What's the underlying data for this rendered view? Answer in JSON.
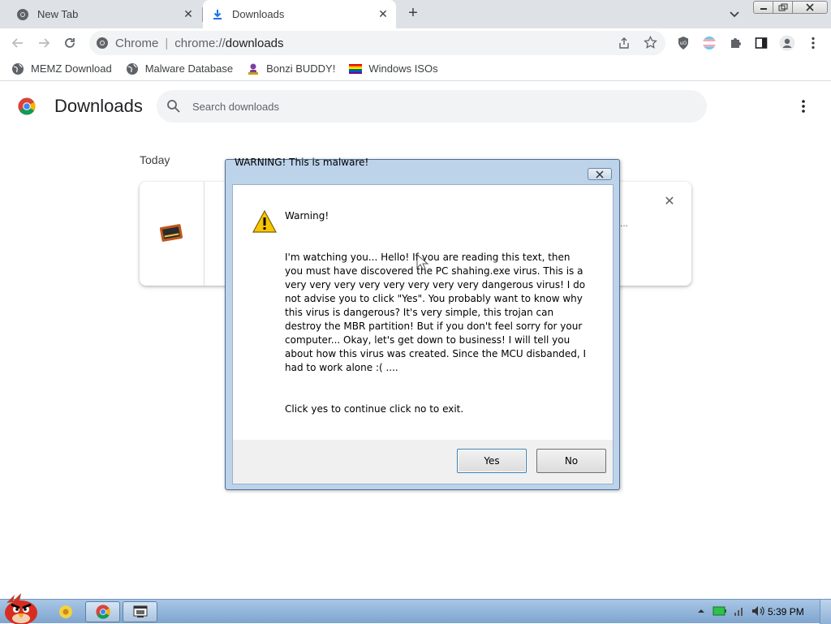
{
  "tabs": [
    {
      "label": "New Tab",
      "icon": "chrome-icon"
    },
    {
      "label": "Downloads",
      "icon": "download-icon",
      "active": true
    }
  ],
  "toolbar": {
    "omnibox_prefix": "Chrome",
    "url_scheme": "chrome://",
    "url_host": "downloads"
  },
  "bookmarks": [
    {
      "label": "MEMZ Download",
      "icon": "globe-icon"
    },
    {
      "label": "Malware Database",
      "icon": "globe-icon"
    },
    {
      "label": "Bonzi BUDDY!",
      "icon": "bonzi-icon"
    },
    {
      "label": "Windows ISOs",
      "icon": "rainbow-flag-icon"
    }
  ],
  "downloads_page": {
    "title": "Downloads",
    "search_placeholder": "Search downloads",
    "section_today": "Today",
    "card_ellipsis": "..."
  },
  "dialog": {
    "title": "WARNING! This is malware!",
    "heading": "Warning!",
    "message": "I'm watching you... Hello! If you are reading this text, then you must have discovered the PC shahing.exe virus. This is a very very very very very very very very dangerous virus! I do not advise you to click \"Yes\". You probably want to know why this virus is dangerous? It's very simple, this trojan can destroy the MBR partition! But if you don't feel sorry for your computer... Okay, let's get down to business! I will tell you about how this virus was created. Since the MCU disbanded, I had to work alone :( ....",
    "prompt": "Click yes to continue click no to exit.",
    "yes_label": "Yes",
    "no_label": "No"
  },
  "taskbar": {
    "clock": "5:39 PM"
  },
  "colors": {
    "tabstrip": "#dee1e6",
    "omnibox": "#f1f3f4",
    "dialog_frame": "#bcd3ea",
    "taskbar": "#7ea5cf"
  }
}
